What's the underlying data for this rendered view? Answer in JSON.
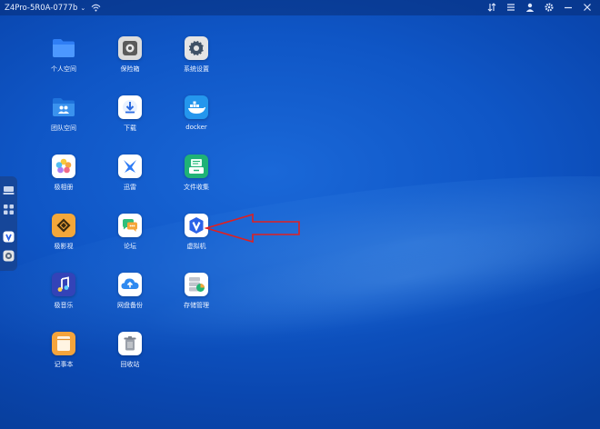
{
  "topbar": {
    "device_name": "Z4Pro-5R0A-0777b",
    "chevron": "⌄",
    "icons": [
      "wifi-icon",
      "sort-icon",
      "menu-icon",
      "user-icon",
      "gear-icon",
      "minimize-icon",
      "close-icon"
    ]
  },
  "dock": {
    "icons": [
      "monitor-icon",
      "apps-grid-icon",
      "virtual-machine-icon",
      "settings-app-icon"
    ]
  },
  "apps": [
    {
      "label": "个人空间",
      "icon": "folder-icon",
      "color": "#3d8dff"
    },
    {
      "label": "保险箱",
      "icon": "safe-icon",
      "color": "#d8d8d8"
    },
    {
      "label": "系统设置",
      "icon": "system-settings-icon",
      "color": "#e0e0e0"
    },
    {
      "label": "团队空间",
      "icon": "team-folder-icon",
      "color": "#2f8df0"
    },
    {
      "label": "下载",
      "icon": "download-icon",
      "color": "#ffffff"
    },
    {
      "label": "docker",
      "icon": "docker-icon",
      "color": "#2496ed"
    },
    {
      "label": "极相册",
      "icon": "photos-icon",
      "color": "#ffffff"
    },
    {
      "label": "迅雷",
      "icon": "thunder-icon",
      "color": "#ffffff"
    },
    {
      "label": "文件收集",
      "icon": "file-collect-icon",
      "color": "#22b573"
    },
    {
      "label": "极影视",
      "icon": "video-icon",
      "color": "#f2a33a"
    },
    {
      "label": "论坛",
      "icon": "forum-icon",
      "color": "#ffffff"
    },
    {
      "label": "虚拟机",
      "icon": "virtual-machine-icon",
      "color": "#ffffff"
    },
    {
      "label": "极音乐",
      "icon": "music-icon",
      "color": "#3a4fc9"
    },
    {
      "label": "网盘备份",
      "icon": "cloud-backup-icon",
      "color": "#ffffff"
    },
    {
      "label": "存储管理",
      "icon": "storage-icon",
      "color": "#ffffff"
    },
    {
      "label": "记事本",
      "icon": "notepad-icon",
      "color": "#f4a43c"
    },
    {
      "label": "回收站",
      "icon": "trash-icon",
      "color": "#ffffff"
    }
  ],
  "annotation": {
    "icon": "red-arrow-icon",
    "color": "#e02020"
  }
}
